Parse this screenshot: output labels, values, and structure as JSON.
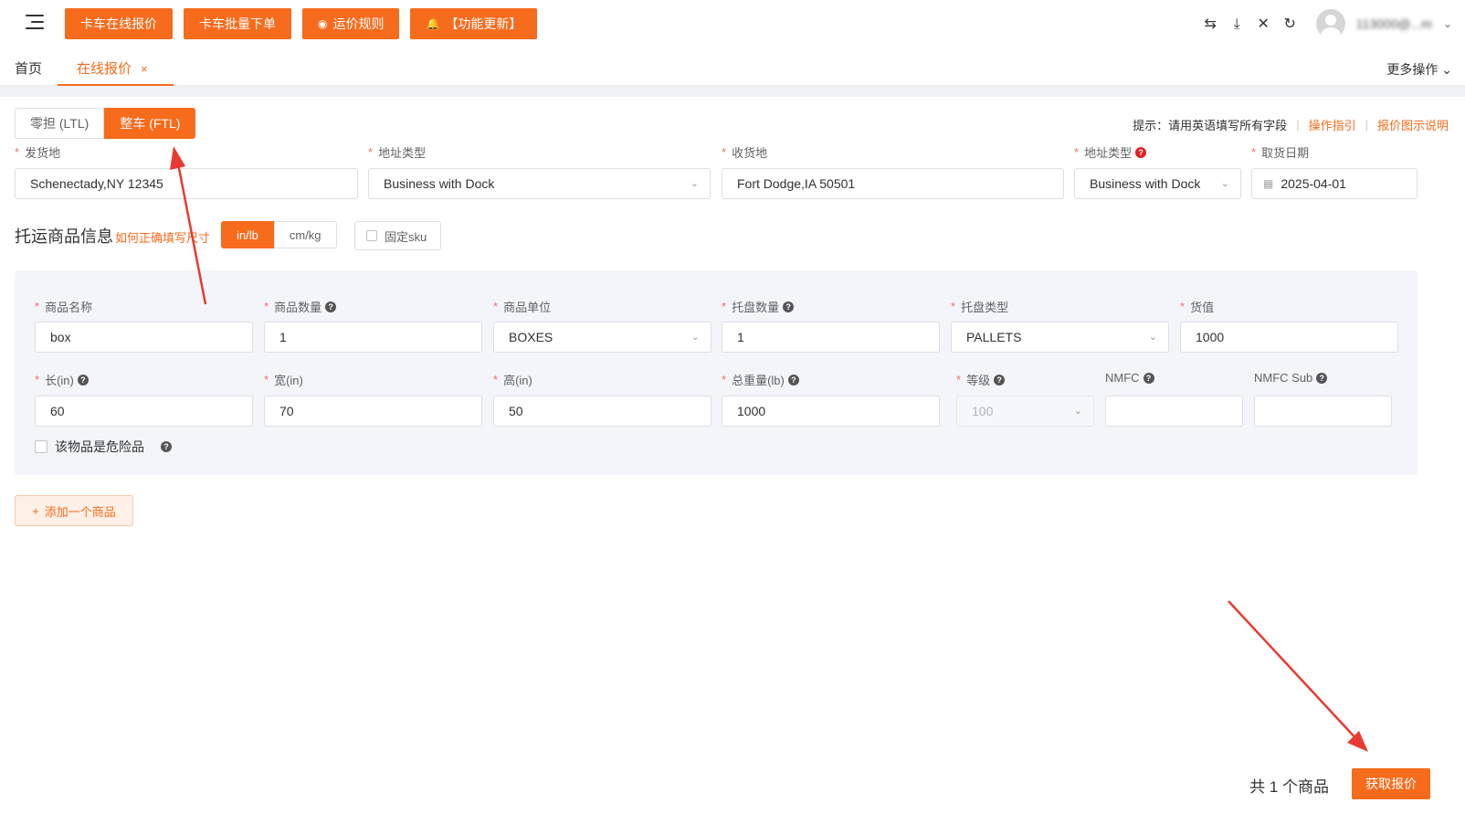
{
  "topbar": {
    "buttons": [
      "卡车在线报价",
      "卡车批量下单",
      "运价规则",
      "【功能更新】"
    ],
    "username": "113000@...m"
  },
  "tabs": {
    "home": "首页",
    "active": "在线报价",
    "close": "×",
    "more": "更多操作"
  },
  "mode": {
    "ltl": "零担 (LTL)",
    "ftl": "整车 (FTL)",
    "selected": "整车 (FTL)"
  },
  "hint": {
    "text": "提示：请用英语填写所有字段",
    "guide": "操作指引",
    "diagram": "报价图示说明"
  },
  "shipment": {
    "origin_label": "发货地",
    "origin_value": "Schenectady,NY 12345",
    "origin_type_label": "地址类型",
    "origin_type_value": "Business with Dock",
    "dest_label": "收货地",
    "dest_value": "Fort Dodge,IA 50501",
    "dest_type_label": "地址类型",
    "dest_type_value": "Business with Dock",
    "pickup_label": "取货日期",
    "pickup_value": "2025-04-01"
  },
  "goods_section": {
    "title": "托运商品信息",
    "size_link": "如何正确填写尺寸",
    "unit_inlb": "in/lb",
    "unit_cmkg": "cm/kg",
    "fixed_sku": "固定sku"
  },
  "item": {
    "name_label": "商品名称",
    "name_value": "box",
    "qty_label": "商品数量",
    "qty_value": "1",
    "unit_label": "商品单位",
    "unit_value": "BOXES",
    "pallet_qty_label": "托盘数量",
    "pallet_qty_value": "1",
    "pallet_type_label": "托盘类型",
    "pallet_type_value": "PALLETS",
    "value_label": "货值",
    "value_value": "1000",
    "length_label": "长(in)",
    "length_value": "60",
    "width_label": "宽(in)",
    "width_value": "70",
    "height_label": "高(in)",
    "height_value": "50",
    "weight_label": "总重量(lb)",
    "weight_value": "1000",
    "class_label": "等级",
    "class_value": "100",
    "nmfc_label": "NMFC",
    "nmfc_value": "",
    "nmfc_sub_label": "NMFC Sub",
    "nmfc_sub_value": "",
    "hazmat_label": "该物品是危险品"
  },
  "actions": {
    "add_item": "添加一个商品",
    "total": "共 1 个商品",
    "get_quote": "获取报价"
  },
  "colors": {
    "accent": "#f76b1c",
    "required": "#f56c6c"
  }
}
